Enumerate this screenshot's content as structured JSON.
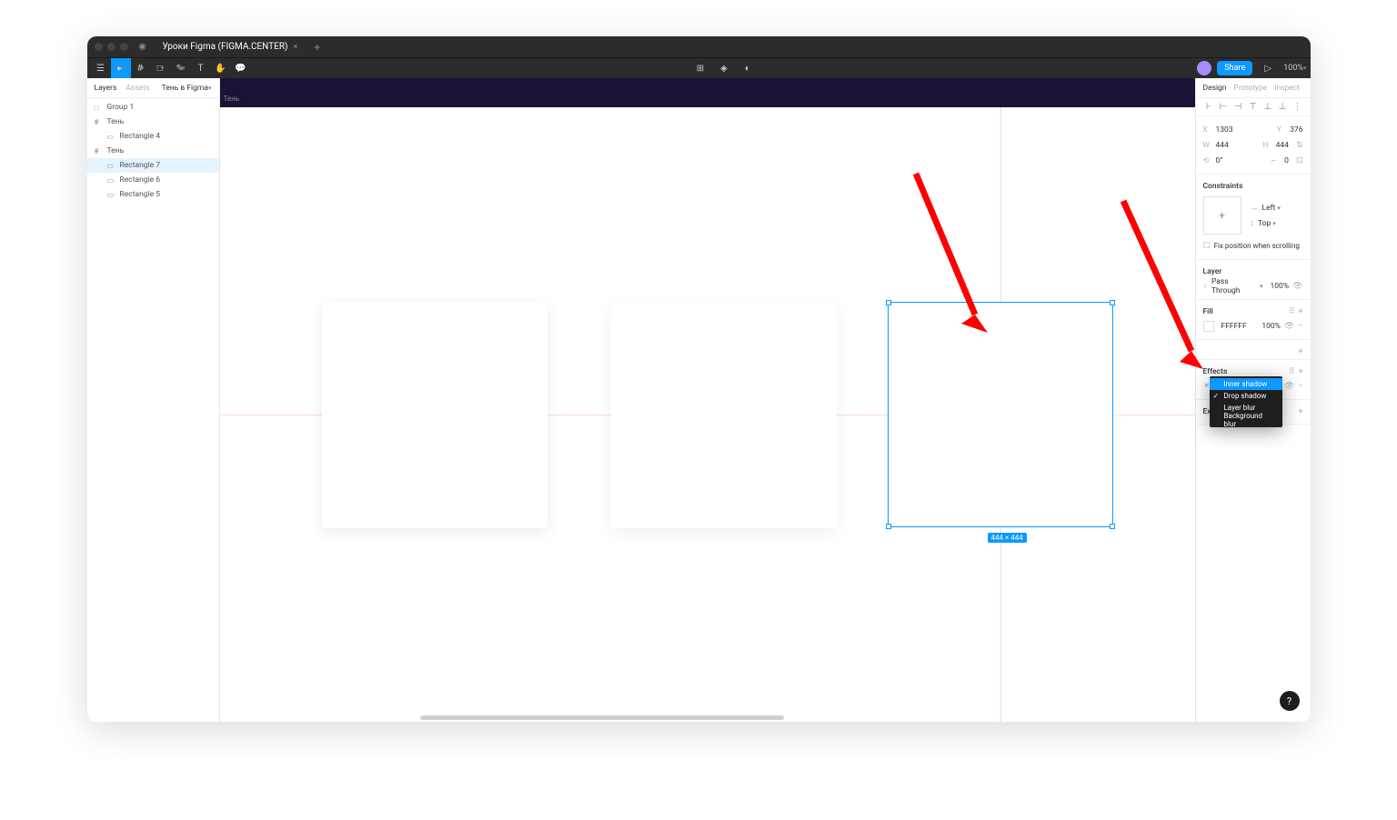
{
  "titlebar": {
    "tab_title": "Уроки Figma (FIGMA.CENTER)"
  },
  "toolbar": {
    "share_label": "Share",
    "zoom": "100%"
  },
  "left_panel": {
    "tab_layers": "Layers",
    "tab_assets": "Assets",
    "page_name": "Тень в Figma",
    "layers": [
      {
        "name": "Group 1",
        "indent": 0,
        "icon": "□"
      },
      {
        "name": "Тень",
        "indent": 0,
        "icon": "#"
      },
      {
        "name": "Rectangle 4",
        "indent": 1,
        "icon": "▭"
      },
      {
        "name": "Тень",
        "indent": 0,
        "icon": "#"
      },
      {
        "name": "Rectangle 7",
        "indent": 1,
        "icon": "▭",
        "selected": true
      },
      {
        "name": "Rectangle 6",
        "indent": 1,
        "icon": "▭"
      },
      {
        "name": "Rectangle 5",
        "indent": 1,
        "icon": "▭"
      }
    ]
  },
  "canvas": {
    "frame_label": "Тень",
    "dimension_label": "444 × 444"
  },
  "right_panel": {
    "tab_design": "Design",
    "tab_prototype": "Prototype",
    "tab_inspect": "Inspect",
    "x_label": "X",
    "x_val": "1303",
    "y_label": "Y",
    "y_val": "376",
    "w_label": "W",
    "w_val": "444",
    "h_label": "H",
    "h_val": "444",
    "rot_label": "⟲",
    "rot_val": "0°",
    "rad_label": "⌐",
    "rad_val": "0",
    "constraints_title": "Constraints",
    "constraint_h": "Left",
    "constraint_v": "Top",
    "fix_scroll": "Fix position when scrolling",
    "layer_title": "Layer",
    "blend_mode": "Pass Through",
    "layer_opacity": "100%",
    "fill_title": "Fill",
    "fill_hex": "FFFFFF",
    "fill_opacity": "100%",
    "effects_title": "Effects",
    "export_title": "Export"
  },
  "dropdown": {
    "items": [
      {
        "label": "Inner shadow",
        "highlighted": true
      },
      {
        "label": "Drop shadow",
        "checked": true
      },
      {
        "label": "Layer blur"
      },
      {
        "label": "Background blur"
      }
    ]
  }
}
